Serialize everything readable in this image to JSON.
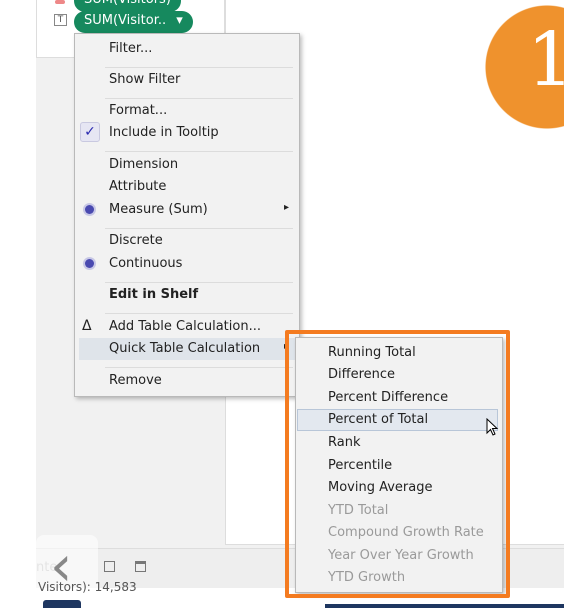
{
  "shelf": {
    "pill_top": "SUM(Visitors)",
    "pill_main": "SUM(Visitor..",
    "pill_arrow": "▾",
    "text_icon": "T"
  },
  "badge": {
    "number": "1",
    "color": "#ef922d"
  },
  "menu": {
    "items": [
      "Filter...",
      "Show Filter",
      "Format...",
      "Include in Tooltip",
      "Dimension",
      "Attribute",
      "Measure (Sum)",
      "Discrete",
      "Continuous",
      "Edit in Shelf",
      "Add Table Calculation...",
      "Quick Table Calculation",
      "Remove"
    ],
    "checked": "Include in Tooltip",
    "selected": [
      "Measure (Sum)",
      "Continuous"
    ],
    "highlighted": "Quick Table Calculation",
    "delta_icon": "Δ",
    "arrow": "▸"
  },
  "submenu": {
    "items": [
      "Running Total",
      "Difference",
      "Percent Difference",
      "Percent of Total",
      "Rank",
      "Percentile",
      "Moving Average",
      "YTD Total",
      "Compound Growth Rate",
      "Year Over Year Growth",
      "YTD Growth"
    ],
    "disabled": [
      "YTD Total",
      "Compound Growth Rate",
      "Year Over Year Growth",
      "YTD Growth"
    ],
    "highlighted": "Percent of Total",
    "highlight_color": "#f47b20"
  },
  "bottom": {
    "partial_text": "nter",
    "status": "Visitors): 14,583",
    "back": "‹"
  }
}
